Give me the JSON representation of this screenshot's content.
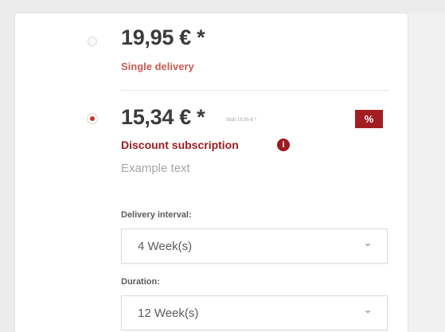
{
  "options": {
    "single": {
      "price": "19,95 € *",
      "label": "Single delivery",
      "selected": false
    },
    "subscription": {
      "price": "15,34 € *",
      "old_price": "Statt 19,95 € *",
      "label": "Discount subscription",
      "badge": "%",
      "info_icon": "i",
      "example_text": "Example text",
      "selected": true
    }
  },
  "fields": {
    "delivery_interval": {
      "label": "Delivery interval:",
      "value": "4 Week(s)"
    },
    "duration": {
      "label": "Duration:",
      "value": "12 Week(s)"
    }
  },
  "colors": {
    "accent": "#9b1b1f",
    "badge": "#a21d22",
    "single_label": "#cb5a53",
    "price_text": "#3b3b3b",
    "muted_text": "#a6a6a6"
  },
  "icons": {
    "info": "info-icon",
    "dropdown": "chevron-down-icon",
    "discount": "percent-badge"
  }
}
